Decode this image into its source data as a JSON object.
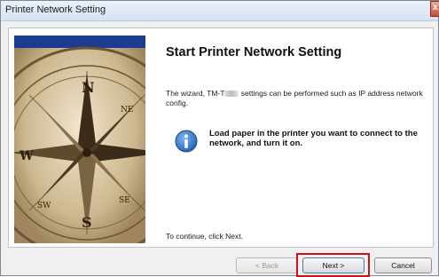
{
  "window": {
    "title": "Printer Network Setting",
    "close_label": "x"
  },
  "main": {
    "heading": "Start Printer Network Setting",
    "desc_prefix": "The wizard, TM-T",
    "desc_suffix": " settings can be performed such as IP address network config.",
    "notice": "Load paper in the printer you want to connect to the network, and turn it on.",
    "continue_text": "To continue, click Next."
  },
  "buttons": {
    "back": "< Back",
    "next": "Next >",
    "cancel": "Cancel"
  },
  "colors": {
    "highlight": "#d0101b",
    "info_icon": "#1f5fb3"
  },
  "icons": {
    "side_image": "compass-image",
    "info": "info-icon"
  }
}
